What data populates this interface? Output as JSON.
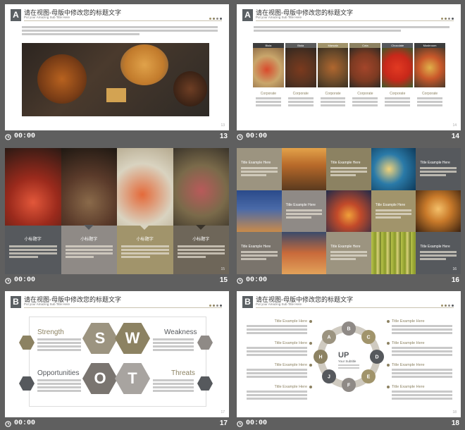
{
  "slides": {
    "s13": {
      "letter": "A",
      "title": "请在视图-母版中修改您的标题文字",
      "subtitle": "Put your Amazing Sub Title Here",
      "time": "00:00",
      "number": "13",
      "page": "13"
    },
    "s14": {
      "letter": "A",
      "title": "请在视图-母版中修改您的标题文字",
      "subtitle": "Put your Amazing Sub Title Here",
      "time": "00:00",
      "number": "14",
      "page": "14",
      "tabs": [
        "Biola",
        "Biola",
        "Marsala",
        "Cota",
        "Chocolate",
        "Mushroom"
      ],
      "card_title": "Corporate"
    },
    "s15": {
      "time": "00:00",
      "number": "15",
      "page": "15",
      "caption": "小标题字"
    },
    "s16": {
      "time": "00:00",
      "number": "16",
      "page": "16",
      "tile_title": "Title Example Here"
    },
    "s17": {
      "letter": "B",
      "title": "请在视图-母版中修改您的标题文字",
      "subtitle": "Put your Amazing Sub Title Here",
      "time": "00:00",
      "number": "17",
      "page": "17",
      "strength": "Strength",
      "weakness": "Weakness",
      "opportunities": "Opportunities",
      "threats": "Threats",
      "s": "S",
      "w": "W",
      "o": "O",
      "t": "T"
    },
    "s18": {
      "letter": "B",
      "title": "请在视图-母版中修改您的标题文字",
      "subtitle": "Put your Amazing Sub Title Here",
      "time": "00:00",
      "number": "18",
      "page": "18",
      "item_title": "Title Example Here",
      "center_big": "UP",
      "center_small": "Your Subtitle",
      "letters": [
        "A",
        "B",
        "C",
        "D",
        "E",
        "F",
        "J",
        "H"
      ]
    }
  },
  "colors": {
    "gold": "#a1946b",
    "olive": "#8c8262",
    "gray": "#8f8a86",
    "dark": "#56595d",
    "taupe": "#9c9480"
  }
}
